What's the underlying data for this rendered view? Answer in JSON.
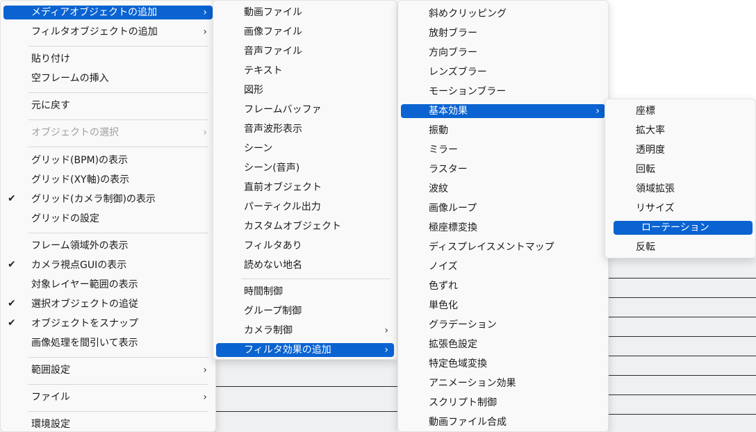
{
  "main_menu": {
    "items": [
      {
        "label": "メディアオブジェクトの追加",
        "sub": true,
        "selected": true
      },
      {
        "label": "フィルタオブジェクトの追加",
        "sub": true
      },
      {
        "label": "貼り付け"
      },
      {
        "label": "空フレームの挿入"
      },
      {
        "label": "元に戻す"
      },
      {
        "label": "オブジェクトの選択",
        "sub": true,
        "disabled": true
      },
      {
        "label": "グリッド(BPM)の表示"
      },
      {
        "label": "グリッド(XY軸)の表示"
      },
      {
        "label": "グリッド(カメラ制御)の表示",
        "checked": true
      },
      {
        "label": "グリッドの設定"
      },
      {
        "label": "フレーム領域外の表示"
      },
      {
        "label": "カメラ視点GUIの表示",
        "checked": true
      },
      {
        "label": "対象レイヤー範囲の表示"
      },
      {
        "label": "選択オブジェクトの追従",
        "checked": true
      },
      {
        "label": "オブジェクトをスナップ",
        "checked": true
      },
      {
        "label": "画像処理を間引いて表示"
      },
      {
        "label": "範囲設定",
        "sub": true
      },
      {
        "label": "ファイル",
        "sub": true
      },
      {
        "label": "環境設定"
      }
    ]
  },
  "media_menu": {
    "items": [
      {
        "label": "動画ファイル"
      },
      {
        "label": "画像ファイル"
      },
      {
        "label": "音声ファイル"
      },
      {
        "label": "テキスト"
      },
      {
        "label": "図形"
      },
      {
        "label": "フレームバッファ"
      },
      {
        "label": "音声波形表示"
      },
      {
        "label": "シーン"
      },
      {
        "label": "シーン(音声)"
      },
      {
        "label": "直前オブジェクト"
      },
      {
        "label": "パーティクル出力"
      },
      {
        "label": "カスタムオブジェクト"
      },
      {
        "label": "フィルタあり"
      },
      {
        "label": "読めない地名"
      },
      {
        "label": "時間制御"
      },
      {
        "label": "グループ制御"
      },
      {
        "label": "カメラ制御",
        "sub": true
      },
      {
        "label": "フィルタ効果の追加",
        "sub": true,
        "selected": true
      }
    ]
  },
  "filter_menu": {
    "items": [
      {
        "label": "斜めクリッピング"
      },
      {
        "label": "放射ブラー"
      },
      {
        "label": "方向ブラー"
      },
      {
        "label": "レンズブラー"
      },
      {
        "label": "モーションブラー"
      },
      {
        "label": "基本効果",
        "sub": true,
        "selected": true
      },
      {
        "label": "振動"
      },
      {
        "label": "ミラー"
      },
      {
        "label": "ラスター"
      },
      {
        "label": "波紋"
      },
      {
        "label": "画像ループ"
      },
      {
        "label": "極座標変換"
      },
      {
        "label": "ディスプレイスメントマップ"
      },
      {
        "label": "ノイズ"
      },
      {
        "label": "色ずれ"
      },
      {
        "label": "単色化"
      },
      {
        "label": "グラデーション"
      },
      {
        "label": "拡張色設定"
      },
      {
        "label": "特定色域変換"
      },
      {
        "label": "アニメーション効果"
      },
      {
        "label": "スクリプト制御"
      },
      {
        "label": "動画ファイル合成"
      }
    ]
  },
  "basic_menu": {
    "items": [
      {
        "label": "座標"
      },
      {
        "label": "拡大率"
      },
      {
        "label": "透明度"
      },
      {
        "label": "回転"
      },
      {
        "label": "領域拡張"
      },
      {
        "label": "リサイズ"
      },
      {
        "label": "ローテーション",
        "selected": true
      },
      {
        "label": "反転"
      }
    ]
  },
  "glyphs": {
    "chevron": "›",
    "check": "✔"
  },
  "colors": {
    "selection": "#0a63d1",
    "menu_bg": "#f9f9f9"
  }
}
